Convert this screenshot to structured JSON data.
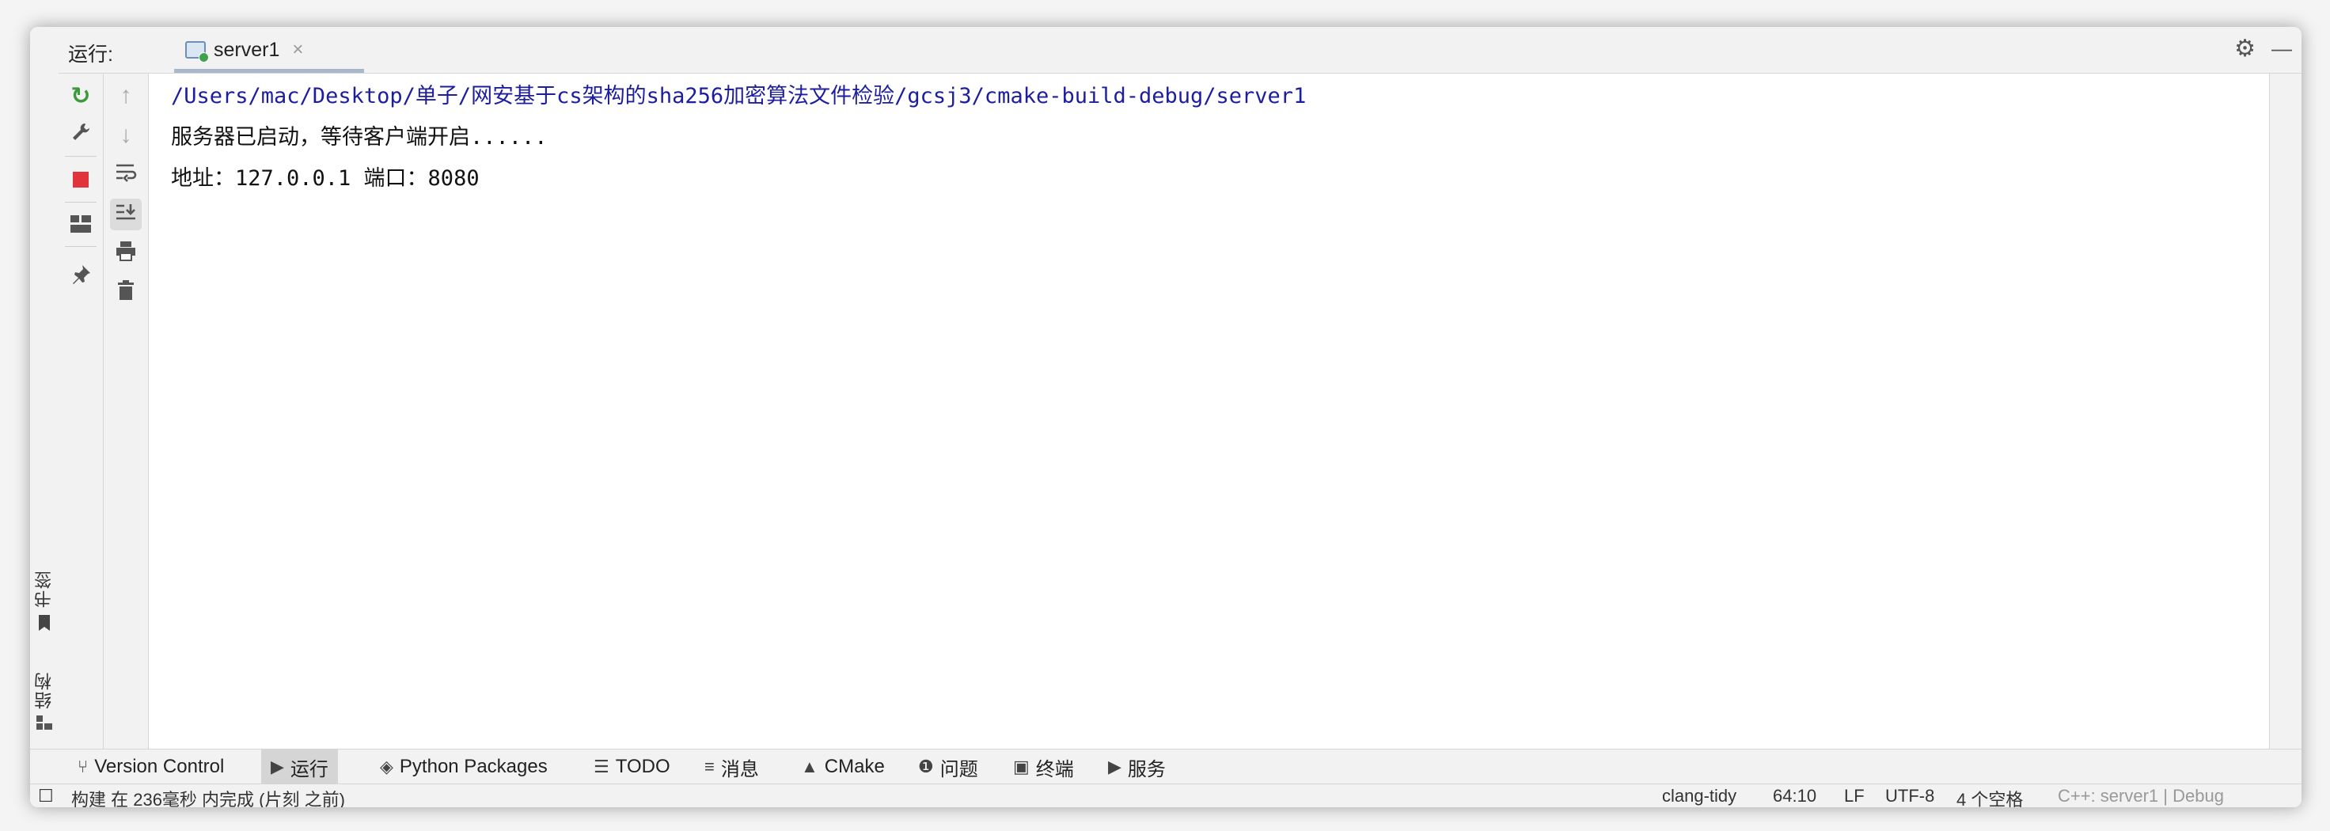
{
  "tabbar": {
    "run_label": "运行:",
    "tab_name": "server1",
    "close_glyph": "×",
    "settings_glyph": "⚙",
    "hide_glyph": "—"
  },
  "side_tabs": [
    {
      "label": "书签",
      "icon": "bookmark-icon"
    },
    {
      "label": "结构",
      "icon": "structure-icon"
    }
  ],
  "toolbar_left": [
    {
      "name": "rerun-icon",
      "glyph": "↻",
      "color": "#3c9a3c"
    },
    {
      "name": "wrench-icon",
      "glyph": "🔧",
      "color": "#555555"
    },
    {
      "name": "stop-icon",
      "glyph": "■",
      "color": "#e0333c"
    },
    {
      "name": "layout-icon",
      "glyph": "▦",
      "color": "#555555"
    },
    {
      "name": "pin-icon",
      "glyph": "📌",
      "color": "#555555"
    }
  ],
  "toolbar_right": [
    {
      "name": "up-arrow-icon",
      "glyph": "↑",
      "color": "#aaaaaa"
    },
    {
      "name": "down-arrow-icon",
      "glyph": "↓",
      "color": "#aaaaaa"
    },
    {
      "name": "soft-wrap-icon",
      "glyph": "↵",
      "color": "#555555"
    },
    {
      "name": "scroll-to-end-icon",
      "glyph": "⇊",
      "color": "#555555"
    },
    {
      "name": "print-icon",
      "glyph": "🖶",
      "color": "#555555"
    },
    {
      "name": "trash-icon",
      "glyph": "🗑",
      "color": "#555555"
    }
  ],
  "console": {
    "lines": [
      "/Users/mac/Desktop/单子/网安基于cs架构的sha256加密算法文件检验/gcsj3/cmake-build-debug/server1",
      "服务器已启动，等待客户端开启......",
      "地址：127.0.0.1 端口：8080"
    ]
  },
  "bottom_tabs": [
    {
      "label": "Version Control",
      "glyph": "⑂"
    },
    {
      "label": "运行",
      "glyph": "▶"
    },
    {
      "label": "Python Packages",
      "glyph": "◈"
    },
    {
      "label": "TODO",
      "glyph": "☰"
    },
    {
      "label": "消息",
      "glyph": "≡"
    },
    {
      "label": "CMake",
      "glyph": "▲"
    },
    {
      "label": "问题",
      "glyph": "❶"
    },
    {
      "label": "终端",
      "glyph": "▣"
    },
    {
      "label": "服务",
      "glyph": "▶"
    }
  ],
  "status": {
    "left": "构建 在 236毫秒 内完成 (片刻 之前)",
    "linter": "clang-tidy",
    "position": "64:10",
    "line_sep": "LF",
    "encoding": "UTF-8",
    "indent": "4 个空格",
    "context": "C++: server1 | Debug"
  },
  "colors": {
    "path_text": "#1d1d9f",
    "stop_red": "#e0333c",
    "rerun_green": "#3c9a3c"
  }
}
